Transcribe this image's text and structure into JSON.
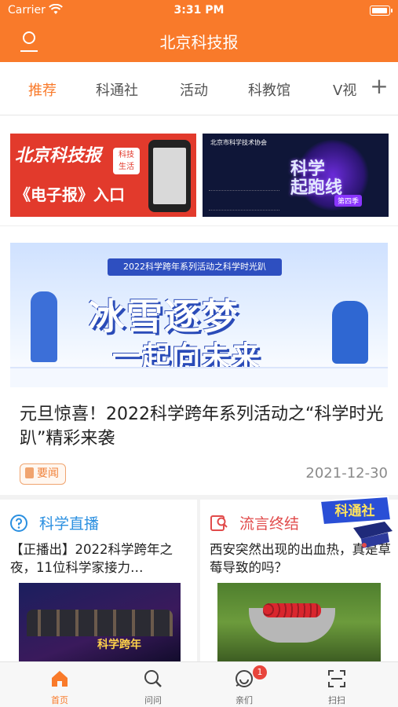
{
  "status_bar": {
    "carrier": "Carrier",
    "time": "3:31 PM"
  },
  "header": {
    "title": "北京科技报"
  },
  "tabs": [
    {
      "label": "推荐",
      "active": true
    },
    {
      "label": "科通社"
    },
    {
      "label": "活动"
    },
    {
      "label": "科教馆"
    },
    {
      "label": "V视"
    }
  ],
  "promos": {
    "epaper": {
      "logo_text": "北京科技报",
      "tag_line1": "科技",
      "tag_line2": "生活",
      "entry_text": "《电子报》入口"
    },
    "race": {
      "org_text": "北京市科学技术协会",
      "big_line1": "科学",
      "big_line2": "起跑线",
      "season": "第四季"
    }
  },
  "feature": {
    "banner_subtitle": "2022科学跨年系列活动之科学时光趴",
    "banner_line1": "冰雪逐梦",
    "banner_line2": "一起向未来",
    "title": "元旦惊喜！2022科学跨年系列活动之“科学时光趴”精彩来袭",
    "tag": "要闻",
    "date": "2021-12-30"
  },
  "cards": {
    "live": {
      "title": "科学直播",
      "text": "【正播出】2022科学跨年之夜，11位科学家接力…",
      "image_caption": "科学跨年"
    },
    "rumor": {
      "title": "流言终结",
      "text": "西安突然出现的出血热，真是草莓导致的吗？"
    },
    "sticker_text": "科通社"
  },
  "tabbar": {
    "items": [
      {
        "label": "首页",
        "icon": "home-icon",
        "active": true
      },
      {
        "label": "问问",
        "icon": "search-icon"
      },
      {
        "label": "亲们",
        "icon": "chat-icon",
        "badge": "1"
      },
      {
        "label": "扫扫",
        "icon": "scan-icon"
      }
    ]
  },
  "colors": {
    "brand": "#f97a2a",
    "live": "#2a8fe0",
    "rumor": "#e14b4b",
    "badge": "#e8453c"
  }
}
